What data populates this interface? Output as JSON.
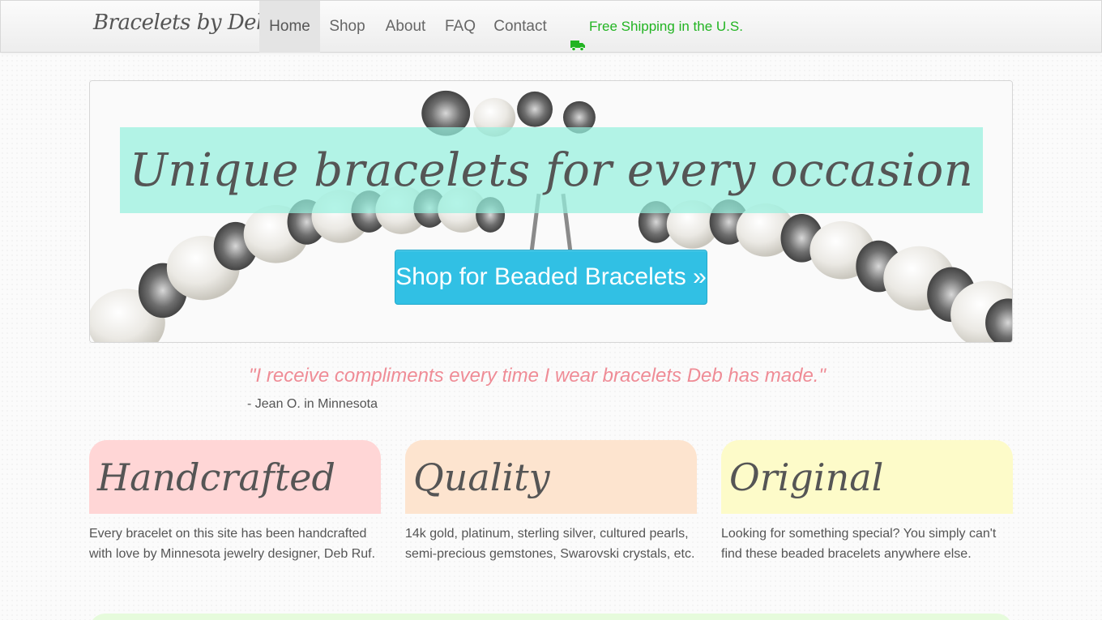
{
  "nav": {
    "brand": "Bracelets by Deb",
    "items": [
      {
        "label": "Home"
      },
      {
        "label": "Shop"
      },
      {
        "label": "About"
      },
      {
        "label": "FAQ"
      },
      {
        "label": "Contact"
      }
    ],
    "shipping": "Free Shipping in the U.S."
  },
  "hero": {
    "title": "Unique bracelets for every occasion",
    "cta": "Shop for Beaded Bracelets »"
  },
  "testimonial": {
    "quote": "\"I receive compliments every time I wear bracelets Deb has made.\"",
    "author": "- Jean O. in Minnesota"
  },
  "features": [
    {
      "title": "Handcrafted",
      "text": "Every bracelet on this site has been handcrafted with love by Minnesota jewelry designer, Deb Ruf."
    },
    {
      "title": "Quality",
      "text": "14k gold, platinum, sterling silver, cultured pearls, semi-precious gemstones, Swarovski crystals, etc."
    },
    {
      "title": "Original",
      "text": "Looking for something special? You simply can't find these beaded bracelets anywhere else."
    }
  ],
  "colors": {
    "accent_cta": "#31c0e4",
    "shipping_green": "#22b422",
    "quote_pink": "#ef8c96",
    "banner_mint": "#96f0de",
    "card_pink": "#ffd6d6",
    "card_peach": "#fde4cf",
    "card_yellow": "#fdfbc9"
  },
  "icons": {
    "shipping": "truck-icon"
  }
}
